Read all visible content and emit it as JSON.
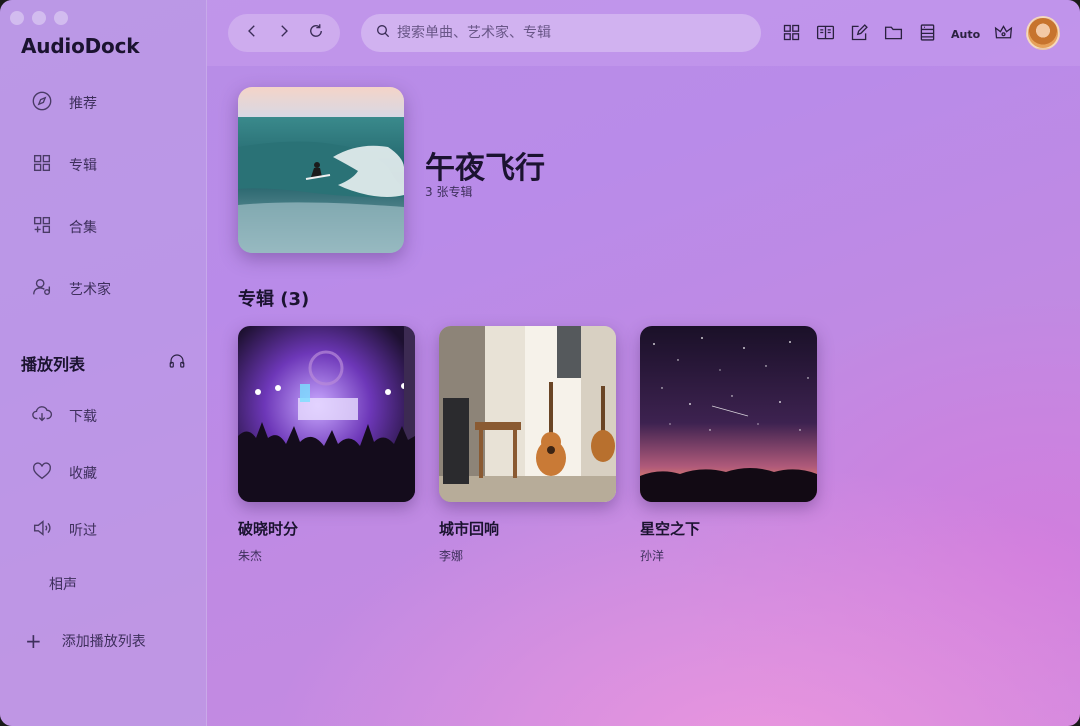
{
  "app": {
    "title": "AudioDock"
  },
  "sidebar": {
    "items": [
      {
        "label": "推荐",
        "icon": "compass-icon"
      },
      {
        "label": "专辑",
        "icon": "grid-icon"
      },
      {
        "label": "合集",
        "icon": "collection-icon"
      },
      {
        "label": "艺术家",
        "icon": "artist-icon"
      }
    ],
    "playlist_section": {
      "title": "播放列表",
      "icon": "headphones-icon"
    },
    "playlist_items": [
      {
        "label": "下载",
        "icon": "cloud-download-icon"
      },
      {
        "label": "收藏",
        "icon": "heart-icon"
      },
      {
        "label": "听过",
        "icon": "speaker-icon"
      }
    ],
    "custom_playlist": "相声",
    "add_playlist": "添加播放列表"
  },
  "toolbar": {
    "search_placeholder": "搜索单曲、艺术家、专辑",
    "auto_label": "Auto"
  },
  "collection": {
    "title": "午夜飞行",
    "subtitle": "3 张专辑",
    "albums_heading": "专辑 (3)",
    "albums": [
      {
        "name": "破晓时分",
        "artist": "朱杰"
      },
      {
        "name": "城市回响",
        "artist": "李娜"
      },
      {
        "name": "星空之下",
        "artist": "孙洋"
      }
    ]
  }
}
